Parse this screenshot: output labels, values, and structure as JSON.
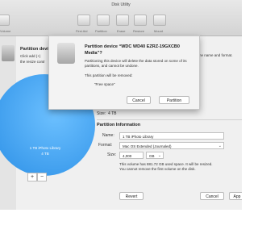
{
  "window": {
    "title": "Disk Utility"
  },
  "toolbar": {
    "items": [
      "Volume",
      "First Aid",
      "Partition",
      "Erase",
      "Restore",
      "Mount"
    ]
  },
  "info": {
    "title": "Partition device",
    "text_line1": "Click add (+)",
    "text_line2": "the resize contr",
    "text_right": "hange the name and format."
  },
  "pie": {
    "label": "1 TB iPhoto Library",
    "size": "4 TB"
  },
  "size_row": {
    "label": "Size:",
    "value": "4 TB"
  },
  "partition_info": {
    "heading": "Partition Information",
    "name_label": "Name:",
    "name_value": "1 TB iPhoto Library",
    "format_label": "Format:",
    "format_value": "Mac OS Extended (Journaled)",
    "size_label": "Size:",
    "size_value": "4,000",
    "size_unit": "GB",
    "note_line1": "This volume has 881.72 GB used space. It will be resized.",
    "note_line2": "You cannot remove the first volume on the disk."
  },
  "buttons": {
    "revert": "Revert",
    "cancel": "Cancel",
    "apply": "App"
  },
  "sheet": {
    "title": "Partition device “WDC WD40 EZRZ-19GXCB0 Media”?",
    "message": "Partitioning this device will delete the data stored on some of its partitions, and cannot be undone.",
    "removed_label": "This partition will be removed:",
    "removed_item": "“Free space”",
    "cancel": "Cancel",
    "partition": "Partition"
  },
  "pm": {
    "plus": "+",
    "minus": "−"
  }
}
